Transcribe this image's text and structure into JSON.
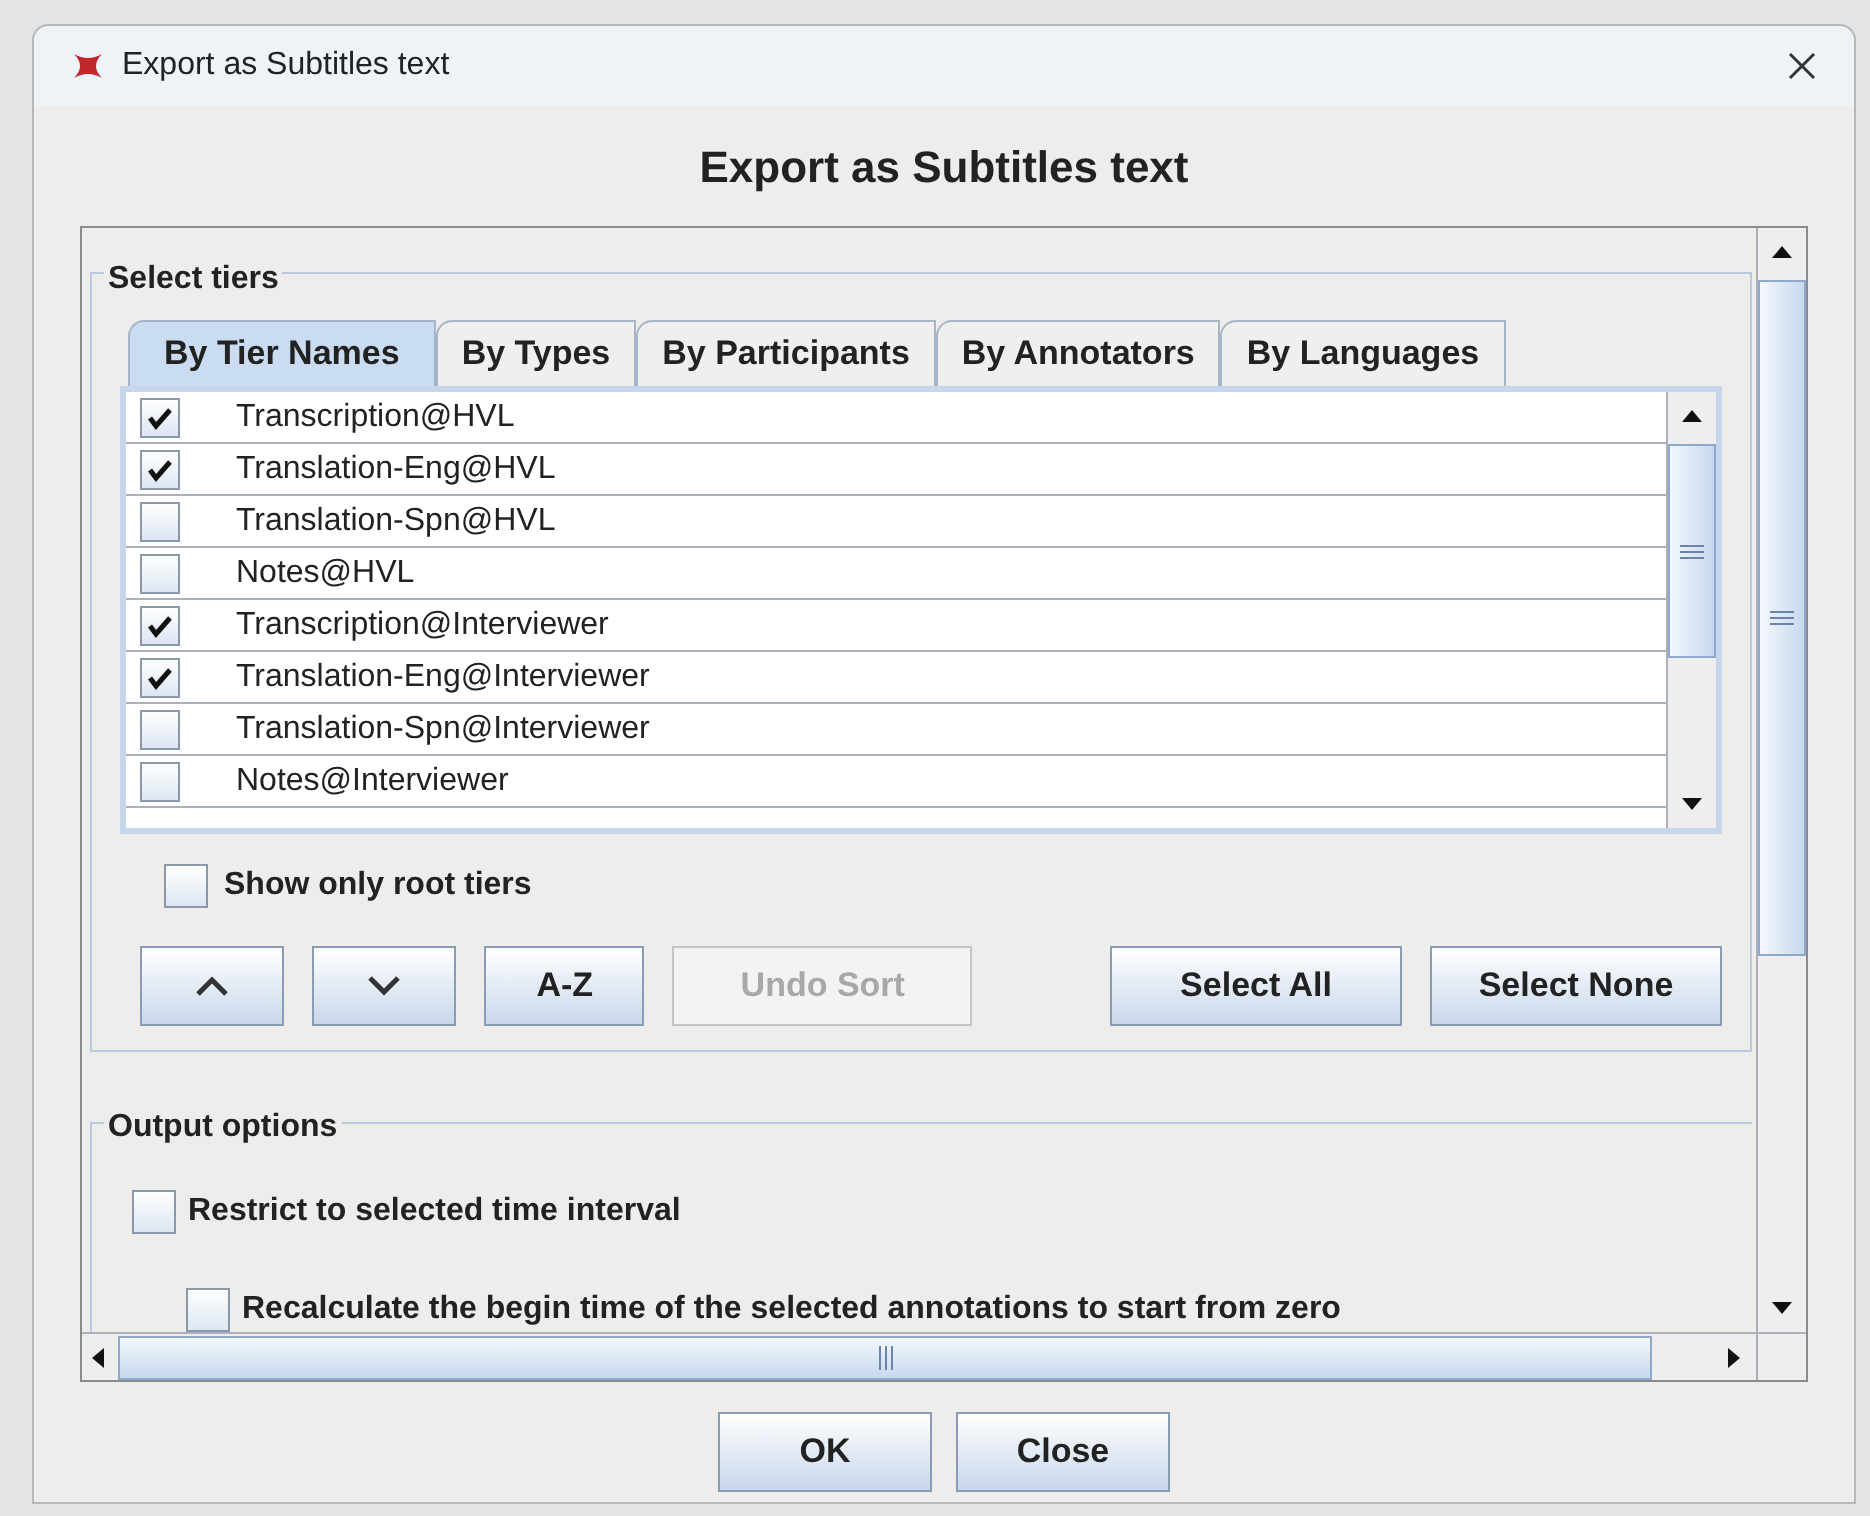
{
  "window": {
    "title": "Export as Subtitles text"
  },
  "heading": "Export as Subtitles text",
  "select_tiers": {
    "title": "Select tiers",
    "tabs": [
      {
        "label": "By Tier Names",
        "selected": true
      },
      {
        "label": "By Types",
        "selected": false
      },
      {
        "label": "By Participants",
        "selected": false
      },
      {
        "label": "By Annotators",
        "selected": false
      },
      {
        "label": "By Languages",
        "selected": false
      }
    ],
    "tiers": [
      {
        "label": "Transcription@HVL",
        "checked": true
      },
      {
        "label": "Translation-Eng@HVL",
        "checked": true
      },
      {
        "label": "Translation-Spn@HVL",
        "checked": false
      },
      {
        "label": "Notes@HVL",
        "checked": false
      },
      {
        "label": "Transcription@Interviewer",
        "checked": true
      },
      {
        "label": "Translation-Eng@Interviewer",
        "checked": true
      },
      {
        "label": "Translation-Spn@Interviewer",
        "checked": false
      },
      {
        "label": "Notes@Interviewer",
        "checked": false
      }
    ],
    "show_only_root": {
      "label": "Show only root tiers",
      "checked": false
    },
    "buttons": [
      {
        "kind": "move_up",
        "disabled": false
      },
      {
        "kind": "move_down",
        "disabled": false
      },
      {
        "kind": "text",
        "label": "A-Z",
        "disabled": false
      },
      {
        "kind": "text",
        "label": "Undo Sort",
        "disabled": true
      },
      {
        "kind": "gap"
      },
      {
        "kind": "text",
        "label": "Select All",
        "disabled": false
      },
      {
        "kind": "text",
        "label": "Select None",
        "disabled": false
      }
    ]
  },
  "output_options": {
    "title": "Output options",
    "options": [
      {
        "label": "Restrict to selected time interval",
        "checked": false,
        "children": [
          {
            "label": "Recalculate the begin time of the selected annotations to start from zero",
            "checked": false
          }
        ]
      }
    ]
  },
  "buttons": [
    "OK",
    "Close"
  ]
}
